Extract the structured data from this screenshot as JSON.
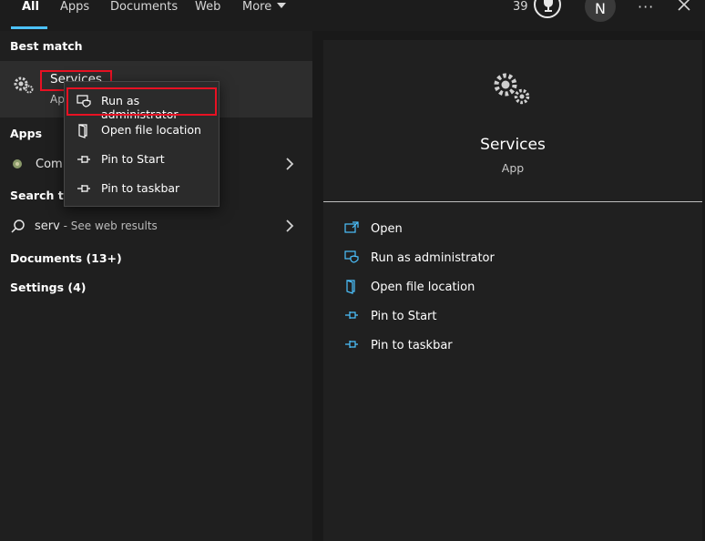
{
  "tabs": [
    {
      "label": "All",
      "active": true
    },
    {
      "label": "Apps"
    },
    {
      "label": "Documents"
    },
    {
      "label": "Web"
    },
    {
      "label": "More"
    }
  ],
  "header": {
    "points": "39",
    "avatar_initial": "N",
    "more_options": "···"
  },
  "left": {
    "best_match_heading": "Best match",
    "best_match": {
      "name": "Services",
      "type": "App"
    },
    "apps_heading": "Apps",
    "apps_item_partial": "Com",
    "search_web_heading_partial": "Search the",
    "web_result": {
      "query": "serv",
      "suffix": " - See web results"
    },
    "documents": "Documents (13+)",
    "settings": "Settings (4)"
  },
  "context_menu": {
    "items": [
      {
        "label": "Run as administrator",
        "icon": "shield-icon"
      },
      {
        "label": "Open file location",
        "icon": "folder-icon"
      },
      {
        "label": "Pin to Start",
        "icon": "pin-icon"
      },
      {
        "label": "Pin to taskbar",
        "icon": "pin-icon"
      }
    ]
  },
  "right": {
    "title": "Services",
    "subtitle": "App",
    "actions": [
      {
        "label": "Open",
        "icon": "open-icon"
      },
      {
        "label": "Run as administrator",
        "icon": "shield-icon"
      },
      {
        "label": "Open file location",
        "icon": "folder-icon"
      },
      {
        "label": "Pin to Start",
        "icon": "pin-icon"
      },
      {
        "label": "Pin to taskbar",
        "icon": "pin-icon"
      }
    ]
  },
  "colors": {
    "accent": "#4cc2ff",
    "highlight_box": "#e81123",
    "background": "#1f1f1f"
  }
}
